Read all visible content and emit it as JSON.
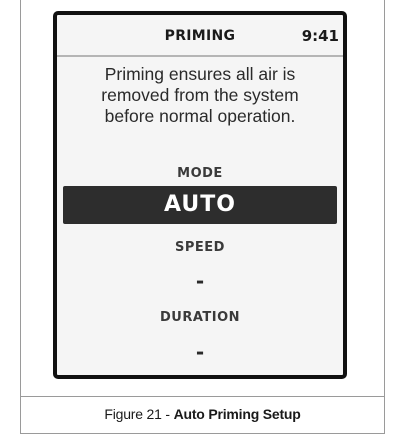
{
  "screen": {
    "header": {
      "title": "PRIMING",
      "time": "9:41"
    },
    "description_lines": [
      "Priming ensures all air is",
      "removed from the system",
      "before normal operation."
    ],
    "mode": {
      "label": "MODE",
      "value": "AUTO"
    },
    "speed": {
      "label": "SPEED",
      "value": "-"
    },
    "duration": {
      "label": "DURATION",
      "value": "-"
    }
  },
  "caption": {
    "prefix": "Figure 21 - ",
    "title": "Auto  Priming Setup"
  },
  "colors": {
    "selected_bar": "#2d2d2d",
    "screen_background": "#f5f5f5",
    "frame": "#111111"
  }
}
